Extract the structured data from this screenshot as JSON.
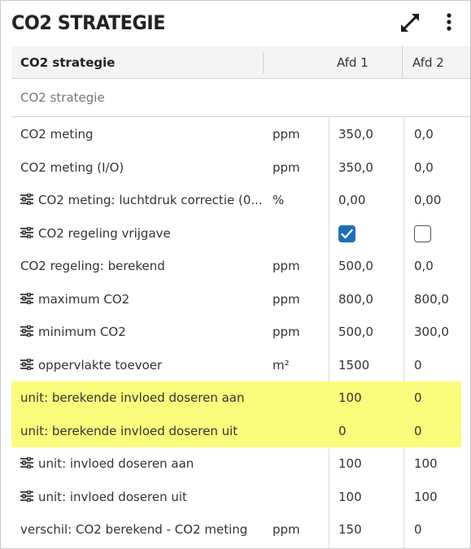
{
  "panel": {
    "title": "CO2 STRATEGIE"
  },
  "table": {
    "headers": {
      "name": "CO2 strategie",
      "afd1": "Afd 1",
      "afd2": "Afd 2"
    },
    "section_label": "CO2 strategie",
    "rows": [
      {
        "name": "CO2 meting",
        "unit": "ppm",
        "afd1": "350,0",
        "afd2": "0,0",
        "settings_icon": false,
        "highlighted": false
      },
      {
        "name": "CO2 meting (I/O)",
        "unit": "ppm",
        "afd1": "350,0",
        "afd2": "0,0",
        "settings_icon": false,
        "highlighted": false
      },
      {
        "name": "CO2 meting: luchtdruk correctie (0...",
        "unit": "%",
        "afd1": "0,00",
        "afd2": "0,00",
        "settings_icon": true,
        "highlighted": false
      },
      {
        "name": "CO2 regeling vrijgave",
        "unit": "",
        "afd1_checked": true,
        "afd2_checked": false,
        "settings_icon": true,
        "highlighted": false
      },
      {
        "name": "CO2 regeling: berekend",
        "unit": "ppm",
        "afd1": "500,0",
        "afd2": "0,0",
        "settings_icon": false,
        "highlighted": false
      },
      {
        "name": "maximum CO2",
        "unit": "ppm",
        "afd1": "800,0",
        "afd2": "800,0",
        "settings_icon": true,
        "highlighted": false
      },
      {
        "name": "minimum CO2",
        "unit": "ppm",
        "afd1": "500,0",
        "afd2": "300,0",
        "settings_icon": true,
        "highlighted": false
      },
      {
        "name": "oppervlakte toevoer",
        "unit": "m²",
        "afd1": "1500",
        "afd2": "0",
        "settings_icon": true,
        "highlighted": false
      },
      {
        "name": "unit: berekende invloed doseren aan",
        "unit": "",
        "afd1": "100",
        "afd2": "0",
        "settings_icon": false,
        "highlighted": true
      },
      {
        "name": "unit: berekende invloed doseren uit",
        "unit": "",
        "afd1": "0",
        "afd2": "0",
        "settings_icon": false,
        "highlighted": true
      },
      {
        "name": "unit: invloed doseren aan",
        "unit": "",
        "afd1": "100",
        "afd2": "100",
        "settings_icon": true,
        "highlighted": false
      },
      {
        "name": "unit: invloed doseren uit",
        "unit": "",
        "afd1": "100",
        "afd2": "100",
        "settings_icon": true,
        "highlighted": false
      },
      {
        "name": "verschil: CO2 berekend - CO2 meting",
        "unit": "ppm",
        "afd1": "150",
        "afd2": "0",
        "settings_icon": false,
        "highlighted": false
      }
    ]
  },
  "icons": {
    "expand": "expand-icon",
    "menu": "more-vertical-icon",
    "settings": "sliders-icon"
  },
  "colors": {
    "highlight": "#fbfc7c",
    "checkbox_checked": "#1e6fb8",
    "header_bg": "#f4f4f4"
  }
}
